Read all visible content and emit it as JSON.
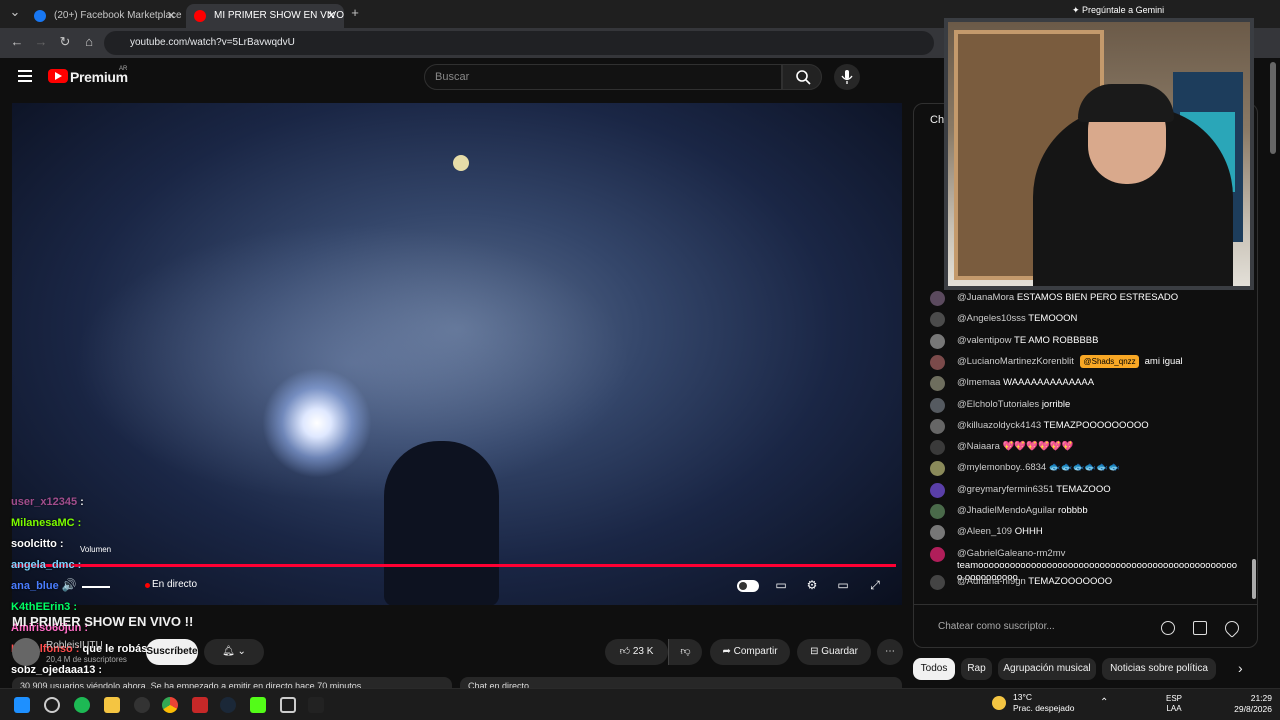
{
  "browser": {
    "tabs": [
      {
        "label": "(20+) Facebook Marketplace | F",
        "favicon_color": "#1877f2"
      },
      {
        "label": "MI PRIMER SHOW EN VIVO",
        "favicon_color": "#ff0000"
      }
    ],
    "new_tab": "+",
    "url": "youtube.com/watch?v=5LrBavwqdvU",
    "gemini_label": "Pregúntale a Gemini"
  },
  "header": {
    "logo_text": "Premium",
    "country": "AR",
    "search_placeholder": "Buscar"
  },
  "player": {
    "live_label": "En directo",
    "volume_tooltip": "Volumen",
    "progress_fraction": 1.0,
    "accent": "#ff0033"
  },
  "overlay_chat": [
    {
      "user": "user_x12345",
      "text": "",
      "color": "#ff6ec7"
    },
    {
      "user": "MilanesaMC",
      "text": "",
      "color": "#7CFC00"
    },
    {
      "user": "soolcitto",
      "text": "",
      "color": "#ffffff"
    },
    {
      "user": "angela_dmc",
      "text": "",
      "color": "#7fd3ff"
    },
    {
      "user": "ana_blue",
      "text": "",
      "color": "#4a7dff"
    },
    {
      "user": "K4thEErin3",
      "text": "",
      "color": "#00ff66"
    },
    {
      "user": "Amirisó6ójun",
      "text": "",
      "color": "#ff6ec7"
    },
    {
      "user": "Luisalfonso",
      "text": "que le robás bro",
      "color": "#ff4d4d"
    },
    {
      "user": "sobz_ojedaaa13",
      "text": "",
      "color": "#ffffff"
    },
    {
      "user": "deslirk",
      "text": "",
      "color": "#ff3333"
    }
  ],
  "video": {
    "title": "MI PRIMER SHOW EN VIVO !!",
    "channel": "RobleisIUTU",
    "subscribers": "20,4 M de suscriptores",
    "subscribe_label": "Suscríbete",
    "likes": "23 K",
    "share_label": "Compartir",
    "save_label": "Guardar",
    "more_label": "⋯",
    "description_preview": "30.909 usuarios viéndolo ahora. Se ha empezado a emitir en directo hace 70 minutos",
    "chat_replay_label": "Chat en directo"
  },
  "chat": {
    "header": "Chat",
    "messages": [
      {
        "author": "@JuanaMora",
        "text": "ESTAMOS BIEN PERO ESTRESADO",
        "avatar": "#5b4a5e"
      },
      {
        "author": "@Angeles10sss",
        "text": "TEMOOON",
        "avatar": "#4b4b4b"
      },
      {
        "author": "@valentipow",
        "text": "TE AMO ROBBBBB",
        "avatar": "#777777"
      },
      {
        "author": "@LucianoMartinezKorenblit",
        "text": "ami igual",
        "mention": "@Shads_qnzz",
        "avatar": "#7a4a4a"
      },
      {
        "author": "@lmemaa",
        "text": "WAAAAAAAAAAAAA",
        "avatar": "#6e6e5e"
      },
      {
        "author": "@ElcholoTutoriales",
        "text": "jorrible",
        "avatar": "#555a60"
      },
      {
        "author": "@killuazoldyck4143",
        "text": "TEMAZPOOOOOOOOO",
        "avatar": "#666666"
      },
      {
        "author": "@Naiaara",
        "text": "💖💖💖💖💖💖",
        "avatar": "#3a3a3a"
      },
      {
        "author": "@mylemonboy..6834",
        "text": "🐟🐟🐟🐟🐟🐟",
        "avatar": "#8a8a5a"
      },
      {
        "author": "@greymaryfermin6351",
        "text": "TEMAZOOO",
        "avatar": "#5a3fa8"
      },
      {
        "author": "@JhadielMendoAguilar",
        "text": "robbbb",
        "avatar": "#4a6a4a"
      },
      {
        "author": "@Aleen_109",
        "text": "OHHH",
        "avatar": "#777777"
      },
      {
        "author": "@GabrielGaleano-rm2mv",
        "text": "teamoooooooooooooooooooooooooooooooooooooooooooooooooo oooooooooo",
        "avatar": "#b01e5a"
      },
      {
        "author": "@Adriana-ni9gn",
        "text": "TEMAZOOOOOOO",
        "avatar": "#444444"
      }
    ],
    "input_placeholder": "Chatear como suscriptor..."
  },
  "chips": [
    {
      "label": "Todos",
      "selected": true
    },
    {
      "label": "Rap",
      "selected": false
    },
    {
      "label": "Agrupación musical",
      "selected": false
    },
    {
      "label": "Noticias sobre política",
      "selected": false
    }
  ],
  "taskbar": {
    "weather_temp": "13°C",
    "weather_desc": "Prac. despejado",
    "lang_top": "ESP",
    "lang_bottom": "LAA",
    "time": "21:29",
    "date": "29/8/2026"
  }
}
